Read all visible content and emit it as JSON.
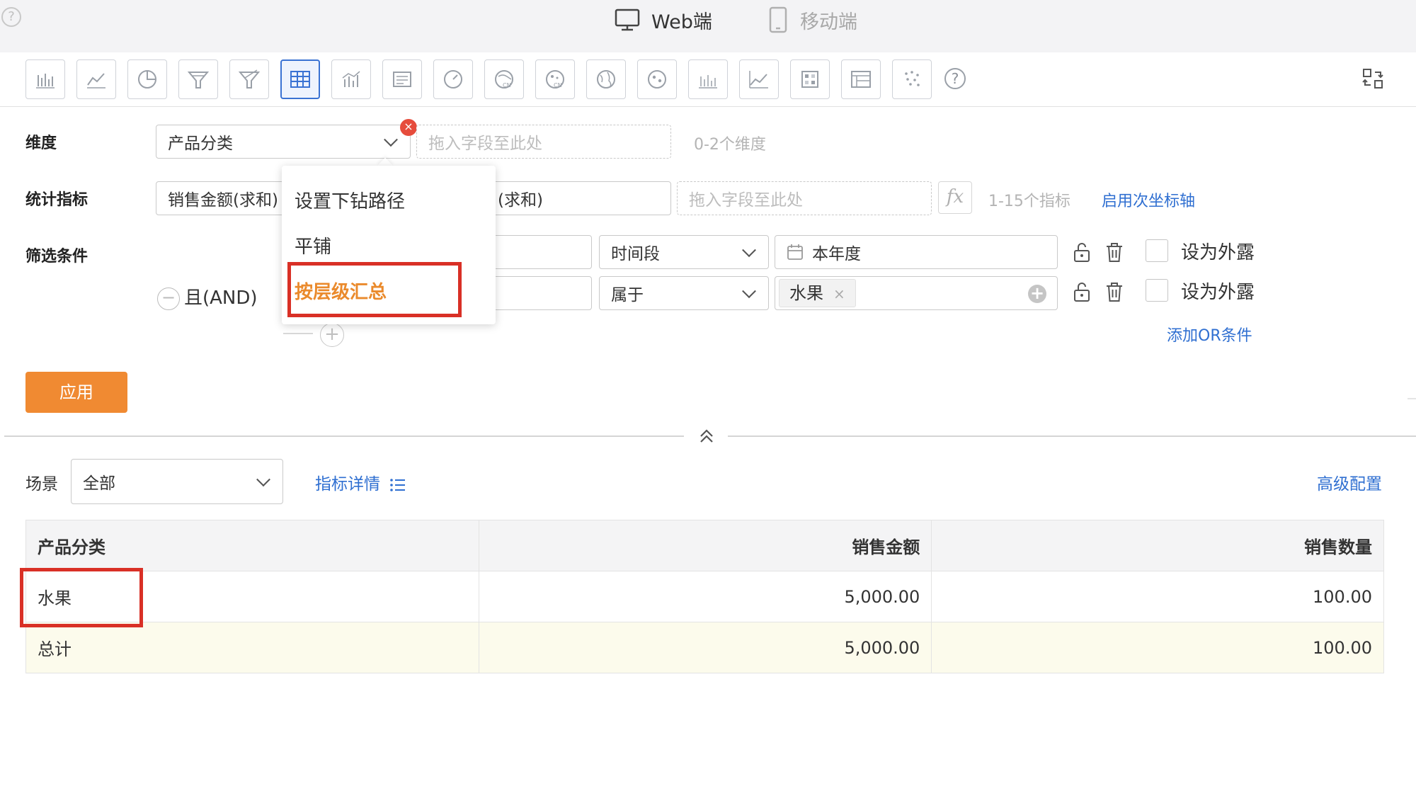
{
  "help_glyph": "?",
  "modes": {
    "web": "Web端",
    "mobile": "移动端"
  },
  "chart_types": [
    {
      "icon": "bar-chart-icon",
      "active": false
    },
    {
      "icon": "line-chart-icon",
      "active": false
    },
    {
      "icon": "pie-chart-icon",
      "active": false
    },
    {
      "icon": "funnel-chart-icon",
      "active": false
    },
    {
      "icon": "multi-funnel-chart-icon",
      "active": false
    },
    {
      "icon": "table-icon",
      "active": true
    },
    {
      "icon": "combo-chart-icon",
      "active": false
    },
    {
      "icon": "card-icon",
      "active": false
    },
    {
      "icon": "gauge-icon",
      "active": false
    },
    {
      "icon": "china-map-icon",
      "active": false
    },
    {
      "icon": "china-bubble-map-icon",
      "active": false
    },
    {
      "icon": "world-map-icon",
      "active": false
    },
    {
      "icon": "world-bubble-map-icon",
      "active": false
    },
    {
      "icon": "horizontal-bar-icon",
      "active": false
    },
    {
      "icon": "area-chart-icon",
      "active": false
    },
    {
      "icon": "heatmap-icon",
      "active": false
    },
    {
      "icon": "pivot-table-icon",
      "active": false
    },
    {
      "icon": "scatter-chart-icon",
      "active": false
    }
  ],
  "dimension": {
    "label": "维度",
    "value": "产品分类",
    "drop_placeholder": "拖入字段至此处",
    "hint": "0-2个维度",
    "close_glyph": "×"
  },
  "metrics": {
    "label": "统计指标",
    "first": "销售金额(求和)",
    "second_tail": "(求和)",
    "drop_placeholder": "拖入字段至此处",
    "fx": "fx",
    "hint": "1-15个指标",
    "secondary_axis_link": "启用次坐标轴"
  },
  "filters": {
    "label": "筛选条件",
    "logic": "且(AND)",
    "minus_glyph": "−",
    "plus_glyph": "+",
    "rows": [
      {
        "operator": "时间段",
        "value": "本年度",
        "expose_label": "设为外露"
      },
      {
        "operator": "属于",
        "tag": "水果",
        "tag_close": "×",
        "expose_label": "设为外露"
      }
    ],
    "add_or_link": "添加OR条件"
  },
  "apply_label": "应用",
  "dropdown_menu": {
    "items": [
      "设置下钻路径",
      "平铺",
      "按层级汇总"
    ],
    "selected_index": 2
  },
  "scene": {
    "label": "场景",
    "value": "全部"
  },
  "indicator_details_link": "指标详情",
  "advanced_config_link": "高级配置",
  "table": {
    "headers": [
      "产品分类",
      "销售金额",
      "销售数量"
    ],
    "rows": [
      [
        "水果",
        "5,000.00",
        "100.00"
      ]
    ],
    "total": [
      "总计",
      "5,000.00",
      "100.00"
    ]
  },
  "colors": {
    "accent_blue": "#2f6fd1",
    "apply_orange": "#f08a32",
    "highlight_red": "#d93026",
    "selected_menu_orange": "#ea8a2c",
    "total_row_bg": "#fcfbec"
  }
}
